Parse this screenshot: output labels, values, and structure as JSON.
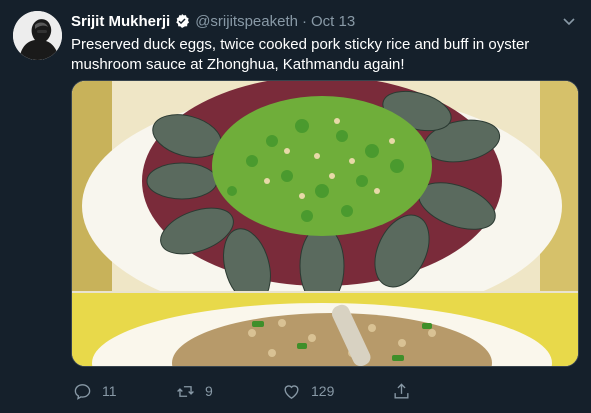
{
  "tweet": {
    "author_name": "Srijit Mukherji",
    "handle": "@srijitspeaketh",
    "separator": "·",
    "date": "Oct 13",
    "text": "Preserved duck eggs, twice cooked pork sticky rice and buff in oyster mushroom sauce at Zhonghua, Kathmandu again!",
    "media": [
      {
        "kind": "photo",
        "subject": "preserved duck eggs with chopped chilies"
      },
      {
        "kind": "photo",
        "subject": "sticky rice"
      }
    ]
  },
  "actions": {
    "reply_count": "11",
    "retweet_count": "9",
    "like_count": "129"
  },
  "icons": [
    "avatar",
    "verified-badge-icon",
    "caret-down-icon",
    "reply-icon",
    "retweet-icon",
    "like-icon",
    "share-icon"
  ],
  "colors": {
    "background": "#15202b",
    "secondary_text": "#8899a6",
    "verified": "#ffffff",
    "border": "#38444d"
  }
}
